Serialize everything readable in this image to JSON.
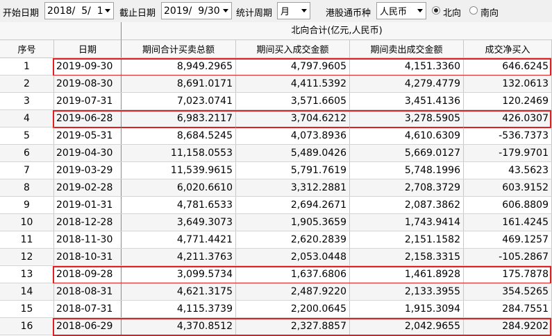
{
  "toolbar": {
    "start_label": "开始日期",
    "start_value": "2018/  5/  1",
    "end_label": "截止日期",
    "end_value": "2019/  9/30",
    "period_label": "统计周期",
    "period_value": "月",
    "currency_label": "港股通币种",
    "currency_value": "人民币",
    "north_label": "北向",
    "south_label": "南向",
    "selected_direction": "north"
  },
  "table": {
    "group_header": "北向合计(亿元,人民币)",
    "columns": [
      "序号",
      "日期",
      "期间合计买卖总额",
      "期间买入成交金额",
      "期间卖出成交金额",
      "成交净买入"
    ],
    "rows": [
      {
        "idx": "1",
        "date": "2019-09-30",
        "total": "8,949.2965",
        "buy": "4,797.9605",
        "sell": "4,151.3360",
        "net": "646.6245",
        "highlighted": true
      },
      {
        "idx": "2",
        "date": "2019-08-30",
        "total": "8,691.0171",
        "buy": "4,411.5392",
        "sell": "4,279.4779",
        "net": "132.0613",
        "highlighted": false
      },
      {
        "idx": "3",
        "date": "2019-07-31",
        "total": "7,023.0741",
        "buy": "3,571.6605",
        "sell": "3,451.4136",
        "net": "120.2469",
        "highlighted": false
      },
      {
        "idx": "4",
        "date": "2019-06-28",
        "total": "6,983.2117",
        "buy": "3,704.6212",
        "sell": "3,278.5905",
        "net": "426.0307",
        "highlighted": true
      },
      {
        "idx": "5",
        "date": "2019-05-31",
        "total": "8,684.5245",
        "buy": "4,073.8936",
        "sell": "4,610.6309",
        "net": "-536.7373",
        "highlighted": false
      },
      {
        "idx": "6",
        "date": "2019-04-30",
        "total": "11,158.0553",
        "buy": "5,489.0426",
        "sell": "5,669.0127",
        "net": "-179.9701",
        "highlighted": false
      },
      {
        "idx": "7",
        "date": "2019-03-29",
        "total": "11,539.9615",
        "buy": "5,791.7619",
        "sell": "5,748.1996",
        "net": "43.5623",
        "highlighted": false
      },
      {
        "idx": "8",
        "date": "2019-02-28",
        "total": "6,020.6610",
        "buy": "3,312.2881",
        "sell": "2,708.3729",
        "net": "603.9152",
        "highlighted": false
      },
      {
        "idx": "9",
        "date": "2019-01-31",
        "total": "4,781.6533",
        "buy": "2,694.2671",
        "sell": "2,087.3862",
        "net": "606.8809",
        "highlighted": false
      },
      {
        "idx": "10",
        "date": "2018-12-28",
        "total": "3,649.3073",
        "buy": "1,905.3659",
        "sell": "1,743.9414",
        "net": "161.4245",
        "highlighted": false
      },
      {
        "idx": "11",
        "date": "2018-11-30",
        "total": "4,771.4421",
        "buy": "2,620.2839",
        "sell": "2,151.1582",
        "net": "469.1257",
        "highlighted": false
      },
      {
        "idx": "12",
        "date": "2018-10-31",
        "total": "4,211.3763",
        "buy": "2,053.0448",
        "sell": "2,158.3315",
        "net": "-105.2867",
        "highlighted": false
      },
      {
        "idx": "13",
        "date": "2018-09-28",
        "total": "3,099.5734",
        "buy": "1,637.6806",
        "sell": "1,461.8928",
        "net": "175.7878",
        "highlighted": true
      },
      {
        "idx": "14",
        "date": "2018-08-31",
        "total": "4,621.3175",
        "buy": "2,487.9220",
        "sell": "2,133.3955",
        "net": "354.5265",
        "highlighted": false
      },
      {
        "idx": "15",
        "date": "2018-07-31",
        "total": "4,115.3739",
        "buy": "2,200.0645",
        "sell": "1,915.3094",
        "net": "284.7551",
        "highlighted": false
      },
      {
        "idx": "16",
        "date": "2018-06-29",
        "total": "4,370.8512",
        "buy": "2,327.8857",
        "sell": "2,042.9655",
        "net": "284.9202",
        "highlighted": true
      }
    ]
  },
  "colors": {
    "highlight": "#e02020"
  }
}
